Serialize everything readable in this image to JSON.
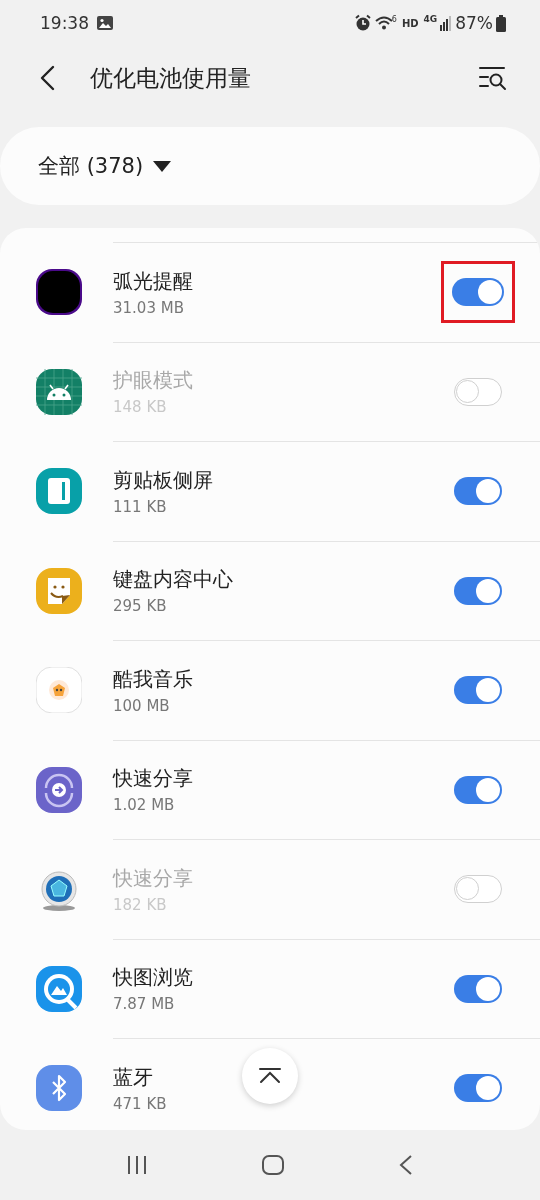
{
  "status_bar": {
    "time": "19:38",
    "wifi_badge": "6",
    "hd": "HD",
    "network": "4G",
    "battery": "87%"
  },
  "header": {
    "title": "优化电池使用量"
  },
  "filter": {
    "label": "全部 (378)"
  },
  "apps": [
    {
      "name": "弧光提醒",
      "size": "31.03 MB",
      "on": true,
      "disabled": false,
      "highlighted": true
    },
    {
      "name": "护眼模式",
      "size": "148 KB",
      "on": false,
      "disabled": true,
      "highlighted": false
    },
    {
      "name": "剪贴板侧屏",
      "size": "111 KB",
      "on": true,
      "disabled": false,
      "highlighted": false
    },
    {
      "name": "键盘内容中心",
      "size": "295 KB",
      "on": true,
      "disabled": false,
      "highlighted": false
    },
    {
      "name": "酷我音乐",
      "size": "100 MB",
      "on": true,
      "disabled": false,
      "highlighted": false
    },
    {
      "name": "快速分享",
      "size": "1.02 MB",
      "on": true,
      "disabled": false,
      "highlighted": false
    },
    {
      "name": "快速分享",
      "size": "182 KB",
      "on": false,
      "disabled": true,
      "highlighted": false
    },
    {
      "name": "快图浏览",
      "size": "7.87 MB",
      "on": true,
      "disabled": false,
      "highlighted": false
    },
    {
      "name": "蓝牙",
      "size": "471 KB",
      "on": true,
      "disabled": false,
      "highlighted": false
    }
  ]
}
